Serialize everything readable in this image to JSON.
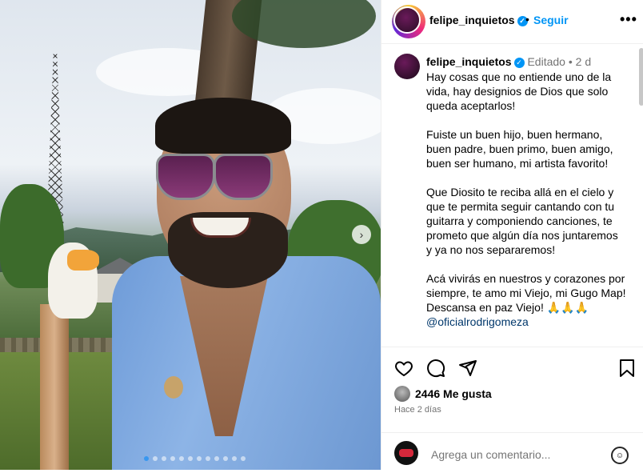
{
  "post": {
    "username": "felipe_inquietos",
    "follow_label": "Seguir",
    "separator": "•",
    "more_label": "•••"
  },
  "caption": {
    "username": "felipe_inquietos",
    "edited_label": "Editado",
    "dot": "•",
    "age": "2 d",
    "text": "Hay cosas que no entiende uno de la vida, hay designios de Dios que solo queda aceptarlos!\n\nFuiste un buen hijo, buen hermano, buen padre, buen primo, buen amigo, buen ser humano, mi artista favorito!\n\nQue Diosito te reciba allá en el cielo y que te permita seguir cantando con tu guitarra y componiendo canciones, te prometo que algún día nos juntaremos y ya no nos separaremos!\n\nAcá vivirás en nuestros y corazones por siempre, te amo mi Viejo, mi Gugo Map!\nDescansa en paz Viejo! 🙏🙏🙏",
    "mention": "@oficialrodrigomeza"
  },
  "actions": {
    "icons": [
      "heart-icon",
      "comment-icon",
      "share-icon",
      "bookmark-icon"
    ],
    "likes": "2446 Me gusta",
    "time": "Hace 2 días"
  },
  "comment": {
    "placeholder": "Agrega un comentario..."
  },
  "carousel": {
    "total": 12,
    "active_index": 0
  },
  "colors": {
    "link_blue": "#0095f6",
    "muted_gray": "#737373",
    "mention": "#00376b"
  }
}
